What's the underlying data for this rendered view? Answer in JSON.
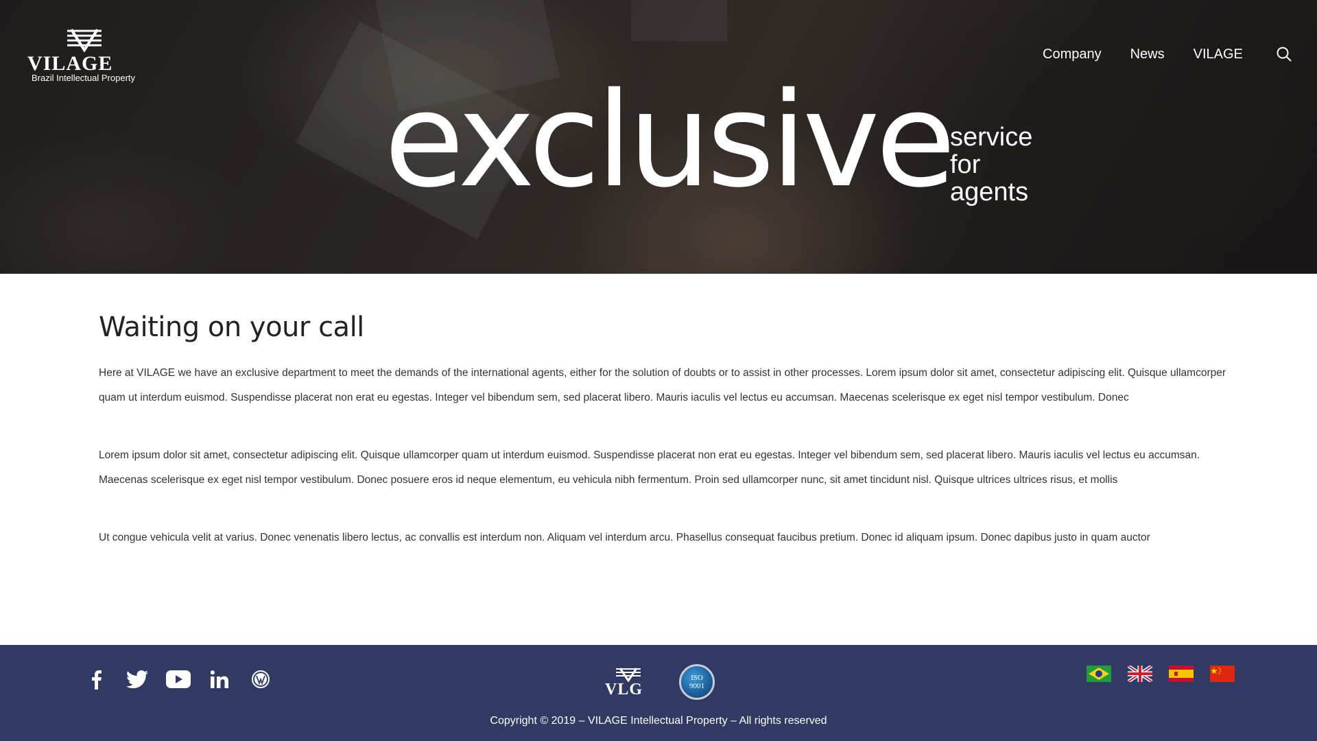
{
  "brand": {
    "name": "VILAGE",
    "tagline": "Brazil Intellectual Property"
  },
  "nav": {
    "items": [
      {
        "label": "Company"
      },
      {
        "label": "News"
      },
      {
        "label": "VILAGE"
      }
    ],
    "search_icon": "search-icon"
  },
  "hero": {
    "headline": "exclusive",
    "side_lines": [
      "service",
      "for",
      "agents"
    ]
  },
  "main": {
    "title": "Waiting on your call",
    "paragraphs": [
      "Here at VILAGE we have an exclusive department to meet the demands of the international agents, either for the solution of doubts or to assist in other processes. Lorem ipsum dolor sit amet, consectetur adipiscing elit. Quisque ullamcorper quam ut interdum euismod. Suspendisse placerat non erat eu egestas. Integer vel bibendum sem, sed placerat libero. Mauris iaculis vel lectus eu accumsan. Maecenas scelerisque ex eget nisl tempor vestibulum. Donec",
      "Lorem ipsum dolor sit amet, consectetur adipiscing elit. Quisque ullamcorper quam ut interdum euismod. Suspendisse placerat non erat eu egestas. Integer vel bibendum sem, sed placerat libero. Mauris iaculis vel lectus eu accumsan. Maecenas scelerisque ex eget nisl tempor vestibulum. Donec posuere eros id neque elementum, eu vehicula nibh fermentum. Proin sed ullamcorper nunc, sit amet tincidunt nisl. Quisque ultrices ultrices risus, et mollis",
      "Ut congue vehicula velit at varius. Donec venenatis libero lectus, ac convallis est interdum non. Aliquam vel interdum arcu. Phasellus consequat faucibus pretium. Donec id aliquam ipsum. Donec dapibus justo in quam auctor"
    ]
  },
  "footer": {
    "socials": [
      "facebook-icon",
      "twitter-icon",
      "youtube-icon",
      "linkedin-icon",
      "wordpress-icon"
    ],
    "badge_vlg": "VLG",
    "badge_iso_top": "ISO",
    "badge_iso_bottom": "9001",
    "flags": [
      "flag-brazil",
      "flag-uk",
      "flag-spain",
      "flag-china"
    ],
    "copyright": "Copyright © 2019 – VILAGE Intellectual Property – All rights reserved"
  },
  "colors": {
    "footer_bg": "#313a63",
    "hero_text": "#ffffff",
    "body_text": "#333333"
  }
}
